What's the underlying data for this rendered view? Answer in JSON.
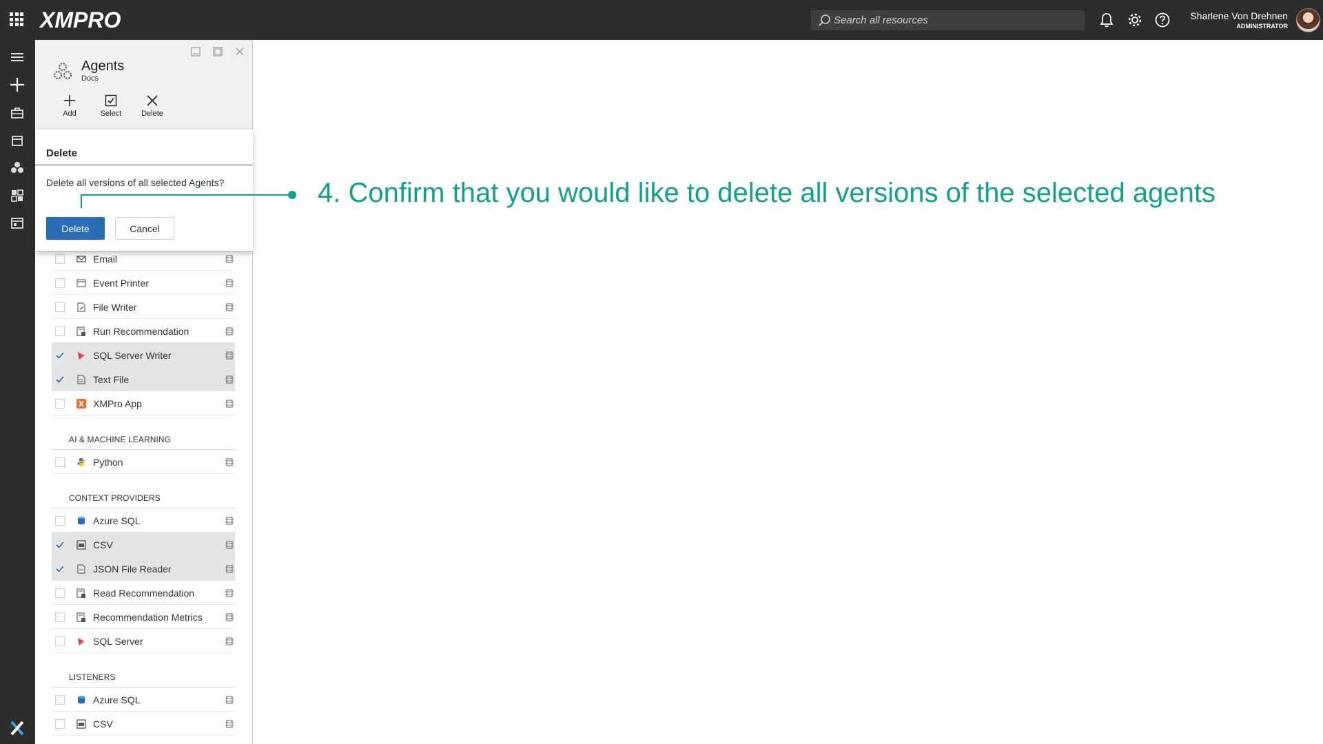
{
  "header": {
    "logo": "XMPRO",
    "search_placeholder": "Search all resources",
    "user_name": "Sharlene Von Drehnen",
    "user_role": "ADMINISTRATOR"
  },
  "panel": {
    "title": "Agents",
    "subtitle": "Docs",
    "toolbar": {
      "add": "Add",
      "select": "Select",
      "delete": "Delete"
    }
  },
  "dialog": {
    "title": "Delete",
    "message": "Delete all versions of all selected Agents?",
    "confirm_label": "Delete",
    "cancel_label": "Cancel"
  },
  "callout": {
    "text": "4. Confirm that you would like to delete all versions of the selected agents",
    "color": "#12a08d"
  },
  "list": {
    "top_items": [
      {
        "label": "Email",
        "icon": "envelope-icon",
        "selected": false
      },
      {
        "label": "Event Printer",
        "icon": "printer-window-icon",
        "selected": false
      },
      {
        "label": "File Writer",
        "icon": "file-pen-icon",
        "selected": false
      },
      {
        "label": "Run Recommendation",
        "icon": "recommendation-icon",
        "selected": false
      },
      {
        "label": "SQL Server Writer",
        "icon": "sql-server-icon",
        "selected": true
      },
      {
        "label": "Text File",
        "icon": "text-file-icon",
        "selected": true
      },
      {
        "label": "XMPro App",
        "icon": "xmpro-app-icon",
        "selected": false
      }
    ],
    "sections": [
      {
        "title": "AI & MACHINE LEARNING",
        "items": [
          {
            "label": "Python",
            "icon": "python-icon",
            "selected": false
          }
        ]
      },
      {
        "title": "CONTEXT PROVIDERS",
        "items": [
          {
            "label": "Azure SQL",
            "icon": "azure-sql-icon",
            "selected": false
          },
          {
            "label": "CSV",
            "icon": "csv-icon",
            "selected": true
          },
          {
            "label": "JSON File Reader",
            "icon": "json-file-icon",
            "selected": true
          },
          {
            "label": "Read Recommendation",
            "icon": "recommendation-icon",
            "selected": false
          },
          {
            "label": "Recommendation Metrics",
            "icon": "recommendation-icon",
            "selected": false
          },
          {
            "label": "SQL Server",
            "icon": "sql-server-icon",
            "selected": false
          }
        ]
      },
      {
        "title": "LISTENERS",
        "items": [
          {
            "label": "Azure SQL",
            "icon": "azure-sql-icon",
            "selected": false
          },
          {
            "label": "CSV",
            "icon": "csv-icon",
            "selected": false
          }
        ]
      }
    ]
  }
}
